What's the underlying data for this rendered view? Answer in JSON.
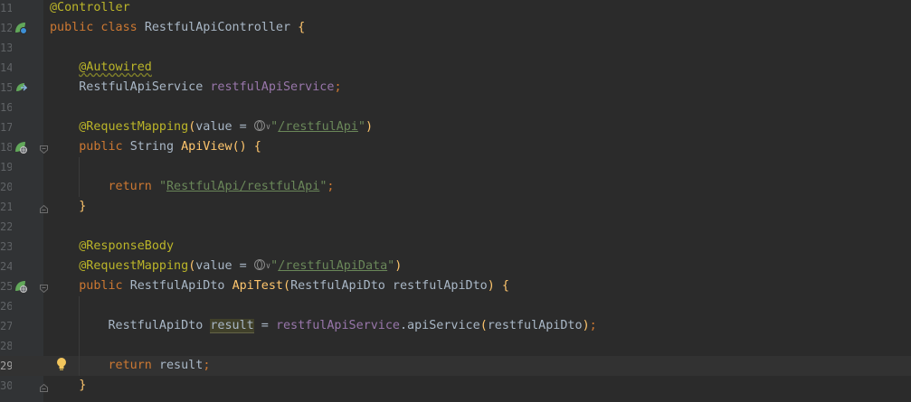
{
  "editor": {
    "current_line": "29",
    "lines": [
      {
        "num": "11",
        "tokens": [
          {
            "t": "ann",
            "v": "@Controller"
          }
        ]
      },
      {
        "num": "12",
        "tokens": [
          {
            "t": "kw",
            "v": "public class "
          },
          {
            "t": "plain",
            "v": "RestfulApiController "
          },
          {
            "t": "fn",
            "v": "{"
          }
        ]
      },
      {
        "num": "13",
        "tokens": []
      },
      {
        "num": "14",
        "tokens": [
          {
            "t": "plain",
            "v": "    "
          },
          {
            "t": "ann-warn",
            "v": "@Autowired"
          }
        ]
      },
      {
        "num": "15",
        "tokens": [
          {
            "t": "plain",
            "v": "    RestfulApiService "
          },
          {
            "t": "field",
            "v": "restfulApiService"
          },
          {
            "t": "kw",
            "v": ";"
          }
        ]
      },
      {
        "num": "16",
        "tokens": []
      },
      {
        "num": "17",
        "tokens": [
          {
            "t": "plain",
            "v": "    "
          },
          {
            "t": "ann",
            "v": "@RequestMapping"
          },
          {
            "t": "fn",
            "v": "("
          },
          {
            "t": "plain",
            "v": "value = "
          },
          {
            "t": "globe",
            "v": ""
          },
          {
            "t": "str",
            "v": "\""
          },
          {
            "t": "str-link",
            "v": "/restfulApi"
          },
          {
            "t": "str",
            "v": "\""
          },
          {
            "t": "fn",
            "v": ")"
          }
        ]
      },
      {
        "num": "18",
        "tokens": [
          {
            "t": "plain",
            "v": "    "
          },
          {
            "t": "kw",
            "v": "public "
          },
          {
            "t": "plain",
            "v": "String "
          },
          {
            "t": "fn",
            "v": "ApiView"
          },
          {
            "t": "fn",
            "v": "() {"
          }
        ]
      },
      {
        "num": "19",
        "tokens": []
      },
      {
        "num": "20",
        "tokens": [
          {
            "t": "plain",
            "v": "        "
          },
          {
            "t": "kw",
            "v": "return "
          },
          {
            "t": "str",
            "v": "\""
          },
          {
            "t": "str-link",
            "v": "RestfulApi/restfulApi"
          },
          {
            "t": "str",
            "v": "\""
          },
          {
            "t": "kw",
            "v": ";"
          }
        ]
      },
      {
        "num": "21",
        "tokens": [
          {
            "t": "plain",
            "v": "    "
          },
          {
            "t": "fn",
            "v": "}"
          }
        ]
      },
      {
        "num": "22",
        "tokens": []
      },
      {
        "num": "23",
        "tokens": [
          {
            "t": "plain",
            "v": "    "
          },
          {
            "t": "ann",
            "v": "@ResponseBody"
          }
        ]
      },
      {
        "num": "24",
        "tokens": [
          {
            "t": "plain",
            "v": "    "
          },
          {
            "t": "ann",
            "v": "@RequestMapping"
          },
          {
            "t": "fn",
            "v": "("
          },
          {
            "t": "plain",
            "v": "value = "
          },
          {
            "t": "globe",
            "v": ""
          },
          {
            "t": "str",
            "v": "\""
          },
          {
            "t": "str-link",
            "v": "/restfulApiData"
          },
          {
            "t": "str",
            "v": "\""
          },
          {
            "t": "fn",
            "v": ")"
          }
        ]
      },
      {
        "num": "25",
        "tokens": [
          {
            "t": "plain",
            "v": "    "
          },
          {
            "t": "kw",
            "v": "public "
          },
          {
            "t": "plain",
            "v": "RestfulApiDto "
          },
          {
            "t": "fn",
            "v": "ApiTest"
          },
          {
            "t": "fn",
            "v": "("
          },
          {
            "t": "plain",
            "v": "RestfulApiDto restfulApiDto"
          },
          {
            "t": "fn",
            "v": ") {"
          }
        ]
      },
      {
        "num": "26",
        "tokens": []
      },
      {
        "num": "27",
        "tokens": [
          {
            "t": "plain",
            "v": "        RestfulApiDto "
          },
          {
            "t": "hl",
            "v": "result"
          },
          {
            "t": "plain",
            "v": " = "
          },
          {
            "t": "field",
            "v": "restfulApiService"
          },
          {
            "t": "plain",
            "v": ".apiService"
          },
          {
            "t": "fn",
            "v": "("
          },
          {
            "t": "plain",
            "v": "restfulApiDto"
          },
          {
            "t": "fn",
            "v": ")"
          },
          {
            "t": "kw",
            "v": ";"
          }
        ]
      },
      {
        "num": "28",
        "tokens": []
      },
      {
        "num": "29",
        "tokens": [
          {
            "t": "plain",
            "v": "        "
          },
          {
            "t": "kw",
            "v": "return "
          },
          {
            "t": "plain",
            "v": "result"
          },
          {
            "t": "kw",
            "v": ";"
          }
        ]
      },
      {
        "num": "30",
        "tokens": [
          {
            "t": "plain",
            "v": "    "
          },
          {
            "t": "fn",
            "v": "}"
          }
        ]
      }
    ]
  },
  "gutter_icons": [
    {
      "line": "12",
      "icon": "spring-bean-icon"
    },
    {
      "line": "15",
      "icon": "autowired-navigate-icon"
    },
    {
      "line": "18",
      "icon": "request-mapping-icon"
    },
    {
      "line": "25",
      "icon": "request-mapping-icon"
    }
  ],
  "fold_markers": [
    {
      "line": "18",
      "kind": "open"
    },
    {
      "line": "21",
      "kind": "close"
    },
    {
      "line": "25",
      "kind": "open"
    },
    {
      "line": "30",
      "kind": "close"
    }
  ],
  "intention_bulb": {
    "line": "29",
    "icon": "lightbulb-icon"
  }
}
